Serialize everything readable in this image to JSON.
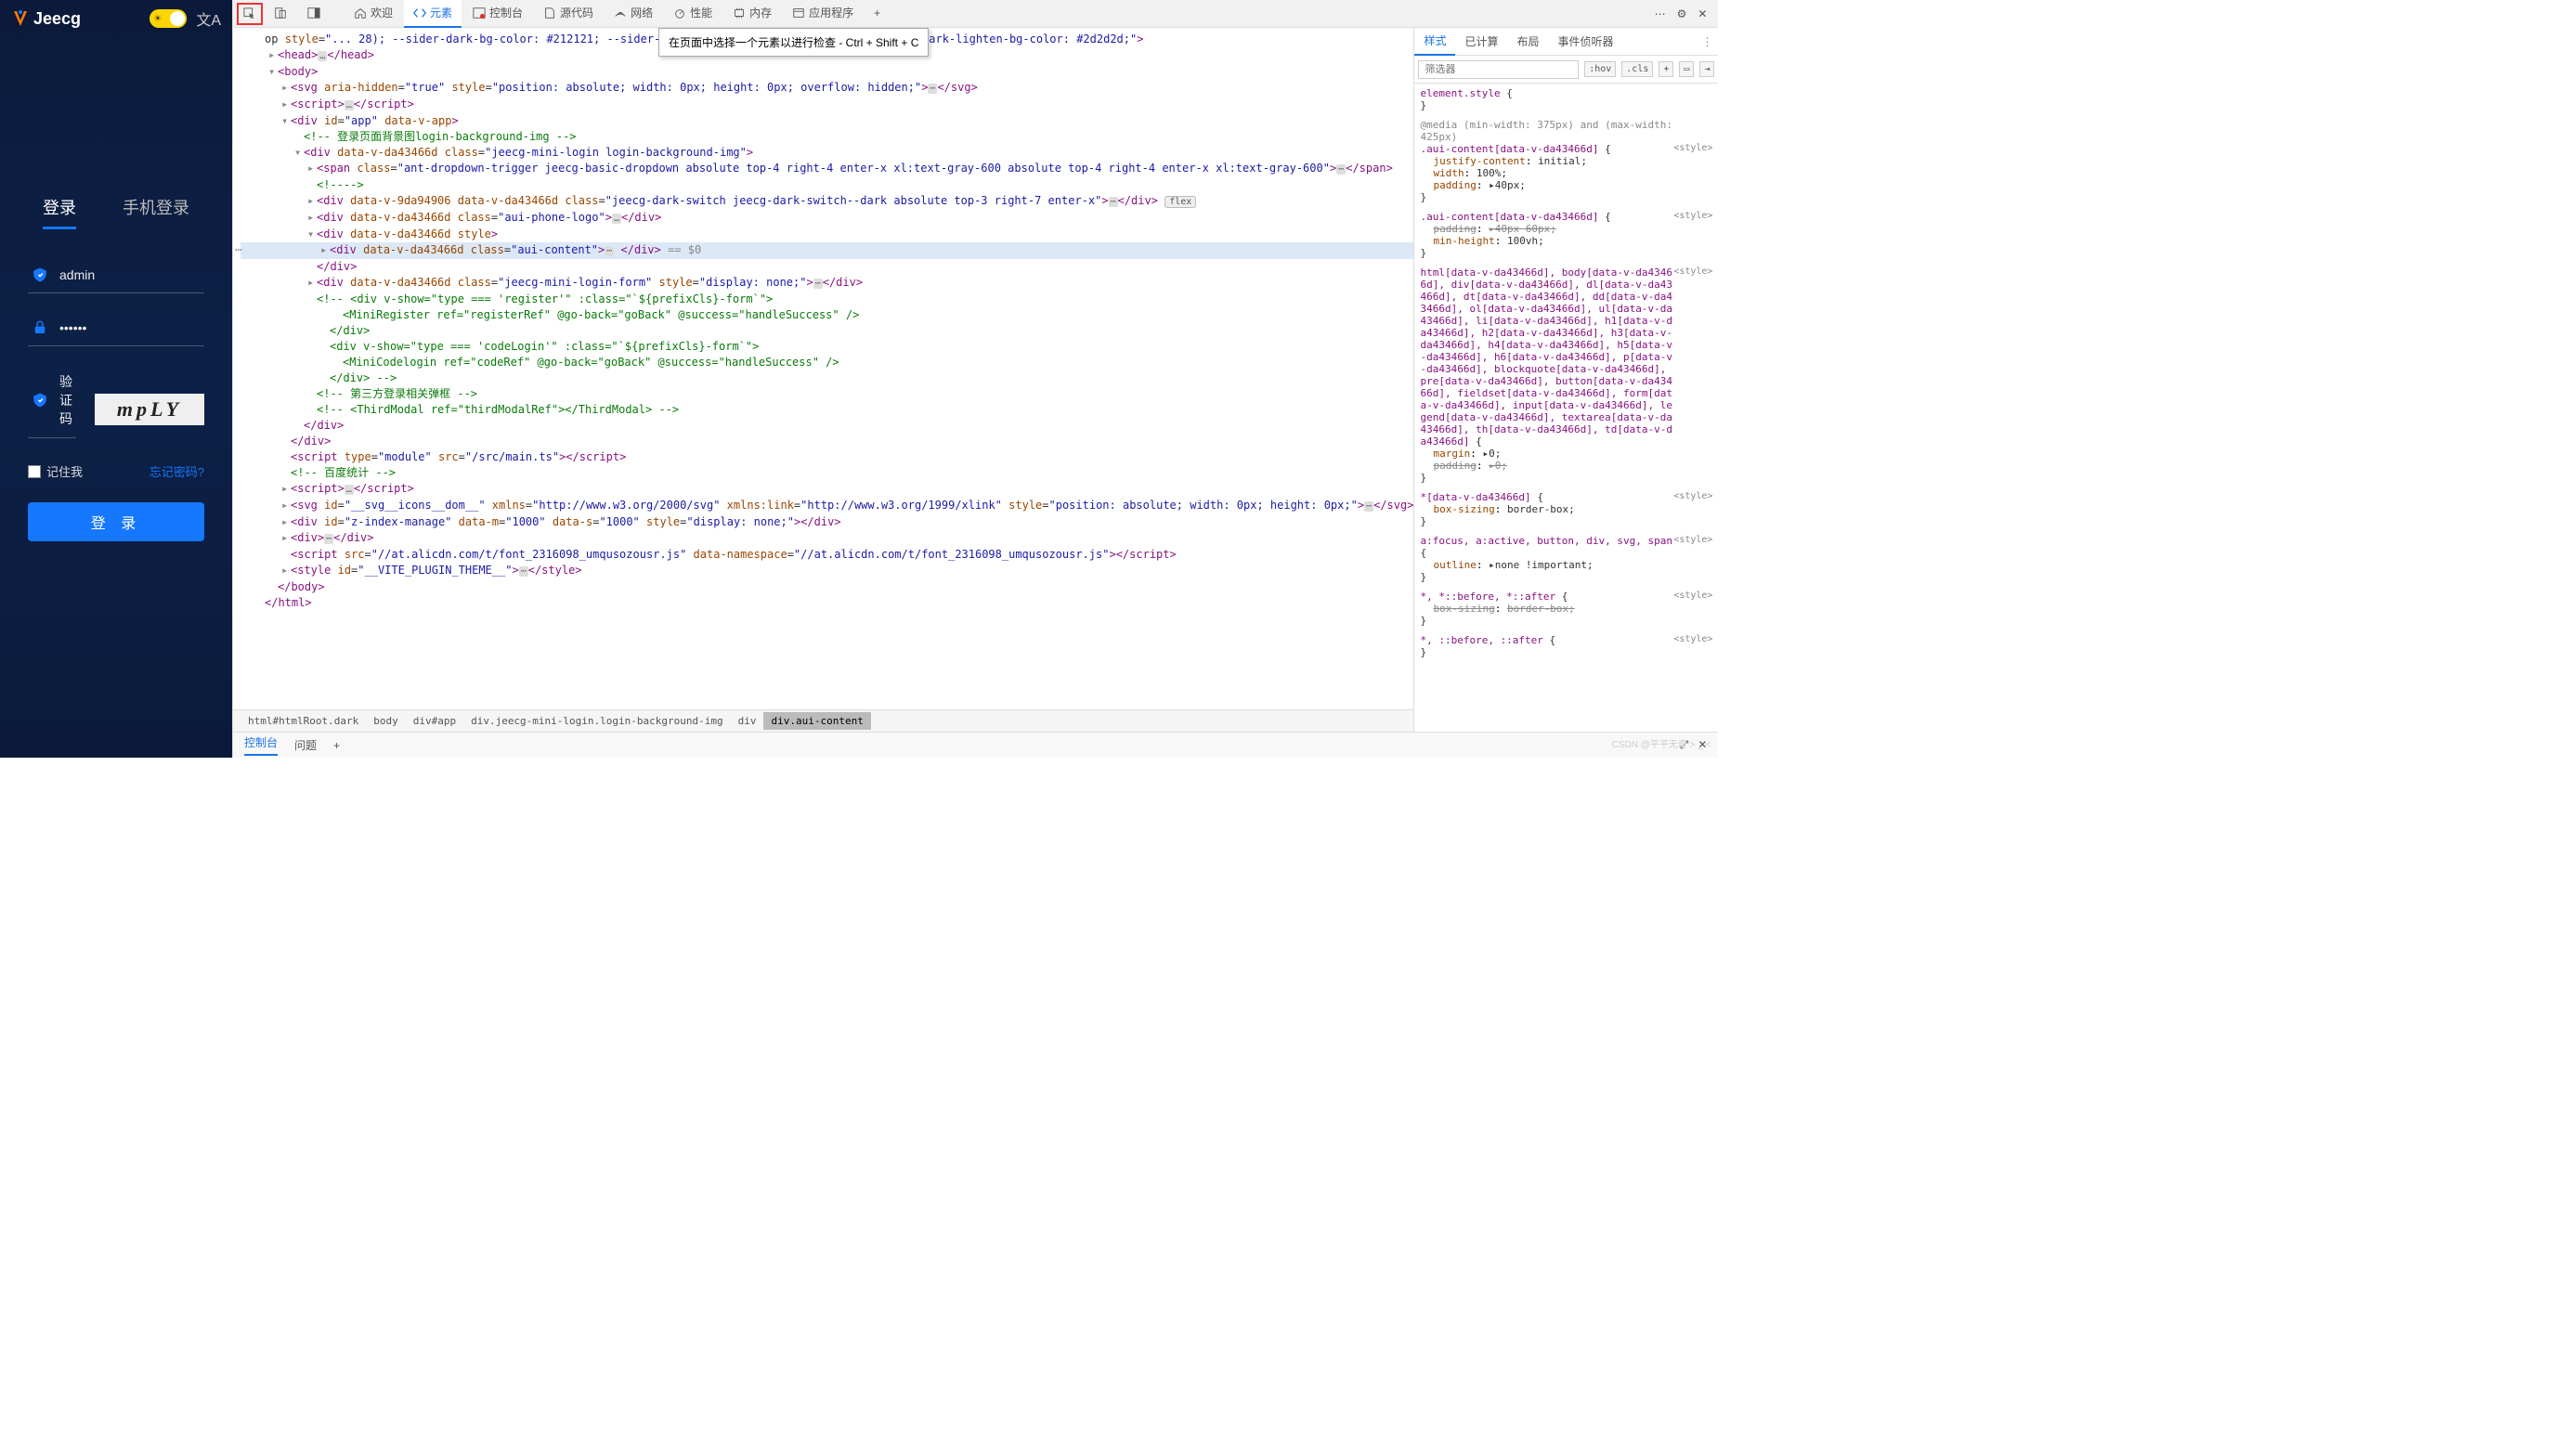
{
  "app": {
    "logo": "Jeecg",
    "tabs": {
      "login": "登录",
      "phone": "手机登录"
    },
    "fields": {
      "username": "admin",
      "password": "••••••",
      "captcha_label": "验证码",
      "captcha_value": "mpLY"
    },
    "remember": "记住我",
    "forgot": "忘记密码?",
    "login_btn": "登 录"
  },
  "devtools": {
    "tabs": {
      "welcome": "欢迎",
      "elements": "元素",
      "console": "控制台",
      "sources": "源代码",
      "network": "网络",
      "performance": "性能",
      "memory": "内存",
      "application": "应用程序"
    },
    "tooltip": "在页面中选择一个元素以进行检查 - Ctrl + Shift + C",
    "crumbs": [
      "html#htmlRoot.dark",
      "body",
      "div#app",
      "div.jeecg-mini-login.login-background-img",
      "div",
      "div.aui-content"
    ],
    "drawer": {
      "console": "控制台",
      "issues": "问题"
    },
    "watermark": "CSDN @平平无奇 > _ <"
  },
  "styles_panel": {
    "tabs": {
      "styles": "样式",
      "computed": "已计算",
      "layout": "布局",
      "listeners": "事件侦听器"
    },
    "filter_placeholder": "筛选器",
    "hov": ":hov",
    "cls": ".cls",
    "rules": [
      {
        "selector": "element.style",
        "src": "",
        "props": []
      },
      {
        "media": "@media (min-width: 375px) and (max-width: 425px)",
        "selector": ".aui-content[data-v-da43466d]",
        "src": "<style>",
        "props": [
          {
            "n": "justify-content",
            "v": "initial;",
            "info": true
          },
          {
            "n": "width",
            "v": "100%;"
          },
          {
            "n": "padding",
            "v": "▸40px;",
            "tri": true
          }
        ]
      },
      {
        "selector": ".aui-content[data-v-da43466d]",
        "src": "<style>",
        "props": [
          {
            "n": "padding",
            "v": "▸40px 60px;",
            "strike": true,
            "tri": true
          },
          {
            "n": "min-height",
            "v": "100vh;"
          }
        ]
      },
      {
        "selector": "html[data-v-da43466d], body[data-v-da43466d], div[data-v-da43466d], dl[data-v-da43466d], dt[data-v-da43466d], dd[data-v-da43466d], ol[data-v-da43466d], ul[data-v-da43466d], li[data-v-da43466d], h1[data-v-da43466d], h2[data-v-da43466d], h3[data-v-da43466d], h4[data-v-da43466d], h5[data-v-da43466d], h6[data-v-da43466d], p[data-v-da43466d], blockquote[data-v-da43466d], pre[data-v-da43466d], button[data-v-da43466d], fieldset[data-v-da43466d], form[data-v-da43466d], input[data-v-da43466d], legend[data-v-da43466d], textarea[data-v-da43466d], th[data-v-da43466d], td[data-v-da43466d]",
        "src": "<style>",
        "props": [
          {
            "n": "margin",
            "v": "▸0;",
            "tri": true
          },
          {
            "n": "padding",
            "v": "▸0;",
            "strike": true,
            "tri": true
          }
        ]
      },
      {
        "selector": "*[data-v-da43466d]",
        "src": "<style>",
        "props": [
          {
            "n": "box-sizing",
            "v": "border-box;"
          }
        ]
      },
      {
        "selector": "a:focus, a:active, button, div, svg, span",
        "src": "<style>",
        "props": [
          {
            "n": "outline",
            "v": "▸none !important;",
            "tri": true
          }
        ]
      },
      {
        "selector": "*, *::before, *::after",
        "src": "<style>",
        "props": [
          {
            "n": "box-sizing",
            "v": "border-box;",
            "strike": true
          }
        ]
      },
      {
        "selector": "*, ::before, ::after",
        "src": "<style>",
        "props": []
      }
    ]
  },
  "dom": [
    {
      "i": 0,
      "h": "op <span class='attr'>style</span>=<span class='val2'>\"... 28); --sider-dark-bg-color: #212121; --sider-dark-darken-bg-color: #121212; --sider-dark-lighten-bg-color: #2d2d2d;\"</span><span class='tag'>></span>"
    },
    {
      "i": 1,
      "t": "▸",
      "h": "<span class='tag'>&lt;head&gt;</span><span class='dots'>…</span><span class='tag'>&lt;/head&gt;</span>"
    },
    {
      "i": 1,
      "t": "▾",
      "h": "<span class='tag'>&lt;body&gt;</span>"
    },
    {
      "i": 2,
      "t": "▸",
      "h": "<span class='tag'>&lt;svg</span> <span class='attr'>aria-hidden</span>=<span class='val2'>\"true\"</span> <span class='attr'>style</span>=<span class='val2'>\"position: absolute; width: 0px; height: 0px; overflow: hidden;\"</span><span class='tag'>&gt;</span><span class='dots'>⋯</span><span class='tag'>&lt;/svg&gt;</span>"
    },
    {
      "i": 2,
      "t": "▸",
      "h": "<span class='tag'>&lt;script&gt;</span><span class='dots'>…</span><span class='tag'>&lt;/script&gt;</span>"
    },
    {
      "i": 2,
      "t": "▾",
      "h": "<span class='tag'>&lt;div</span> <span class='attr'>id</span>=<span class='val2'>\"app\"</span> <span class='attr'>data-v-app</span><span class='tag'>&gt;</span>"
    },
    {
      "i": 3,
      "h": "<span class='cmt'>&lt;!-- 登录页面背景图login-background-img --&gt;</span>"
    },
    {
      "i": 3,
      "t": "▾",
      "h": "<span class='tag'>&lt;div</span> <span class='attr'>data-v-da43466d</span> <span class='attr'>class</span>=<span class='val2'>\"jeecg-mini-login login-background-img\"</span><span class='tag'>&gt;</span>"
    },
    {
      "i": 4,
      "t": "▸",
      "h": "<span class='tag'>&lt;span</span> <span class='attr'>class</span>=<span class='val2'>\"ant-dropdown-trigger jeecg-basic-dropdown absolute top-4 right-4 enter-x xl:text-gray-600 absolute top-4 right-4 enter-x xl:text-gray-600\"</span><span class='tag'>&gt;</span><span class='dots'>⋯</span><span class='tag'>&lt;/span&gt;</span>"
    },
    {
      "i": 4,
      "h": "<span class='cmt'>&lt;!----&gt;</span>"
    },
    {
      "i": 4,
      "t": "▸",
      "h": "<span class='tag'>&lt;div</span> <span class='attr'>data-v-9da94906</span> <span class='attr'>data-v-da43466d</span> <span class='attr'>class</span>=<span class='val2'>\"jeecg-dark-switch jeecg-dark-switch--dark absolute top-3 right-7 enter-x\"</span><span class='tag'>&gt;</span><span class='dots'>⋯</span><span class='tag'>&lt;/div&gt;</span> <span class='flex-b'>flex</span>"
    },
    {
      "i": 4,
      "t": "▸",
      "h": "<span class='tag'>&lt;div</span> <span class='attr'>data-v-da43466d</span> <span class='attr'>class</span>=<span class='val2'>\"aui-phone-logo\"</span><span class='tag'>&gt;</span><span class='dots'>…</span><span class='tag'>&lt;/div&gt;</span>"
    },
    {
      "i": 4,
      "t": "▾",
      "h": "<span class='tag'>&lt;div</span> <span class='attr'>data-v-da43466d</span> <span class='attr'>style</span><span class='tag'>&gt;</span>"
    },
    {
      "i": 5,
      "t": "▸",
      "sel": true,
      "ld": "⋯",
      "h": "<span class='tag'>&lt;div</span> <span class='attr'>data-v-da43466d</span> <span class='attr'>class</span>=<span class='val2'>\"aui-content\"</span><span class='tag'>&gt;</span><span class='dots'>⋯</span> <span class='tag'>&lt;/div&gt;</span> <span class='eq0'>== $0</span>"
    },
    {
      "i": 4,
      "h": "<span class='tag'>&lt;/div&gt;</span>"
    },
    {
      "i": 4,
      "t": "▸",
      "h": "<span class='tag'>&lt;div</span> <span class='attr'>data-v-da43466d</span> <span class='attr'>class</span>=<span class='val2'>\"jeecg-mini-login-form\"</span> <span class='attr'>style</span>=<span class='val2'>\"display: none;\"</span><span class='tag'>&gt;</span><span class='dots'>⋯</span><span class='tag'>&lt;/div&gt;</span>"
    },
    {
      "i": 4,
      "h": "<span class='cmt'>&lt;!-- &lt;div v-show=\"type === 'register'\" :class=\"`${prefixCls}-form`\"&gt;</span>"
    },
    {
      "i": 6,
      "h": "<span class='cmt'>&lt;MiniRegister ref=\"registerRef\" @go-back=\"goBack\" @success=\"handleSuccess\" /&gt;</span>"
    },
    {
      "i": 5,
      "h": "<span class='cmt'>&lt;/div&gt;</span>"
    },
    {
      "i": 5,
      "h": "<span class='cmt'>&lt;div v-show=\"type === 'codeLogin'\" :class=\"`${prefixCls}-form`\"&gt;</span>"
    },
    {
      "i": 6,
      "h": "<span class='cmt'>&lt;MiniCodelogin ref=\"codeRef\" @go-back=\"goBack\" @success=\"handleSuccess\" /&gt;</span>"
    },
    {
      "i": 5,
      "h": "<span class='cmt'>&lt;/div&gt; --&gt;</span>"
    },
    {
      "i": 4,
      "h": "<span class='cmt'>&lt;!-- 第三方登录相关弹框 --&gt;</span>"
    },
    {
      "i": 4,
      "h": "<span class='cmt'>&lt;!-- &lt;ThirdModal ref=\"thirdModalRef\"&gt;&lt;/ThirdModal&gt; --&gt;</span>"
    },
    {
      "i": 3,
      "h": "<span class='tag'>&lt;/div&gt;</span>"
    },
    {
      "i": 2,
      "h": "<span class='tag'>&lt;/div&gt;</span>"
    },
    {
      "i": 2,
      "h": "<span class='tag'>&lt;script</span> <span class='attr'>type</span>=<span class='val2'>\"module\"</span> <span class='attr'>src</span>=<span class='val2'>\"/src/main.ts\"</span><span class='tag'>&gt;&lt;/script&gt;</span>"
    },
    {
      "i": 2,
      "h": "<span class='cmt'>&lt;!-- 百度统计 --&gt;</span>"
    },
    {
      "i": 2,
      "t": "▸",
      "h": "<span class='tag'>&lt;script&gt;</span><span class='dots'>…</span><span class='tag'>&lt;/script&gt;</span>"
    },
    {
      "i": 2,
      "t": "▸",
      "h": "<span class='tag'>&lt;svg</span> <span class='attr'>id</span>=<span class='val2'>\"__svg__icons__dom__\"</span> <span class='attr'>xmlns</span>=<span class='val2'>\"http://www.w3.org/2000/svg\"</span> <span class='attr'>xmlns:link</span>=<span class='val2'>\"http://www.w3.org/1999/xlink\"</span> <span class='attr'>style</span>=<span class='val2'>\"position: absolute; width: 0px; height: 0px;\"</span><span class='tag'>&gt;</span><span class='dots'>⋯</span><span class='tag'>&lt;/svg&gt;</span>"
    },
    {
      "i": 2,
      "t": "▸",
      "h": "<span class='tag'>&lt;div</span> <span class='attr'>id</span>=<span class='val2'>\"z-index-manage\"</span> <span class='attr'>data-m</span>=<span class='val2'>\"1000\"</span> <span class='attr'>data-s</span>=<span class='val2'>\"1000\"</span> <span class='attr'>style</span>=<span class='val2'>\"display: none;\"</span><span class='tag'>&gt;&lt;/div&gt;</span>"
    },
    {
      "i": 2,
      "t": "▸",
      "h": "<span class='tag'>&lt;div&gt;</span><span class='dots'>⋯</span><span class='tag'>&lt;/div&gt;</span>"
    },
    {
      "i": 2,
      "h": "<span class='tag'>&lt;script</span> <span class='attr'>src</span>=<span class='val2'>\"//at.alicdn.com/t/font_2316098_umqusozousr.js\"</span> <span class='attr'>data-namespace</span>=<span class='val2'>\"//at.alicdn.com/t/font_2316098_umqusozousr.js\"</span><span class='tag'>&gt;&lt;/script&gt;</span>"
    },
    {
      "i": 2,
      "t": "▸",
      "h": "<span class='tag'>&lt;style</span> <span class='attr'>id</span>=<span class='val2'>\"__VITE_PLUGIN_THEME__\"</span><span class='tag'>&gt;</span><span class='dots'>⋯</span><span class='tag'>&lt;/style&gt;</span>"
    },
    {
      "i": 1,
      "h": "<span class='tag'>&lt;/body&gt;</span>"
    },
    {
      "i": 0,
      "h": "<span class='tag'>&lt;/html&gt;</span>"
    }
  ]
}
